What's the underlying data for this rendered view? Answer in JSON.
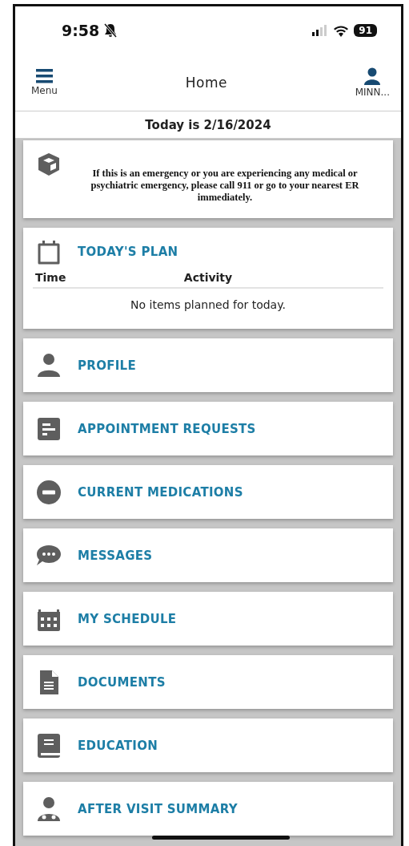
{
  "status_bar": {
    "time": "9:58",
    "silent": true,
    "battery": "91"
  },
  "header": {
    "menu_label": "Menu",
    "title": "Home",
    "user_label": "MINN..."
  },
  "date_bar": "Today is 2/16/2024",
  "notice": {
    "text": "If this is an emergency or you are experiencing any medical or psychiatric emergency, please call 911 or go to your nearest ER immediately."
  },
  "plan": {
    "title": "TODAY'S PLAN",
    "columns": [
      "Time",
      "Activity"
    ],
    "empty": "No items planned for today."
  },
  "menu_cards": [
    {
      "kind": "person",
      "label": "PROFILE"
    },
    {
      "kind": "form",
      "label": "APPOINTMENT REQUESTS"
    },
    {
      "kind": "minus",
      "label": "CURRENT MEDICATIONS"
    },
    {
      "kind": "chat",
      "label": "MESSAGES"
    },
    {
      "kind": "schedule",
      "label": "MY SCHEDULE"
    },
    {
      "kind": "document",
      "label": "DOCUMENTS"
    },
    {
      "kind": "book",
      "label": "EDUCATION"
    },
    {
      "kind": "doctor",
      "label": "AFTER VISIT SUMMARY"
    }
  ]
}
